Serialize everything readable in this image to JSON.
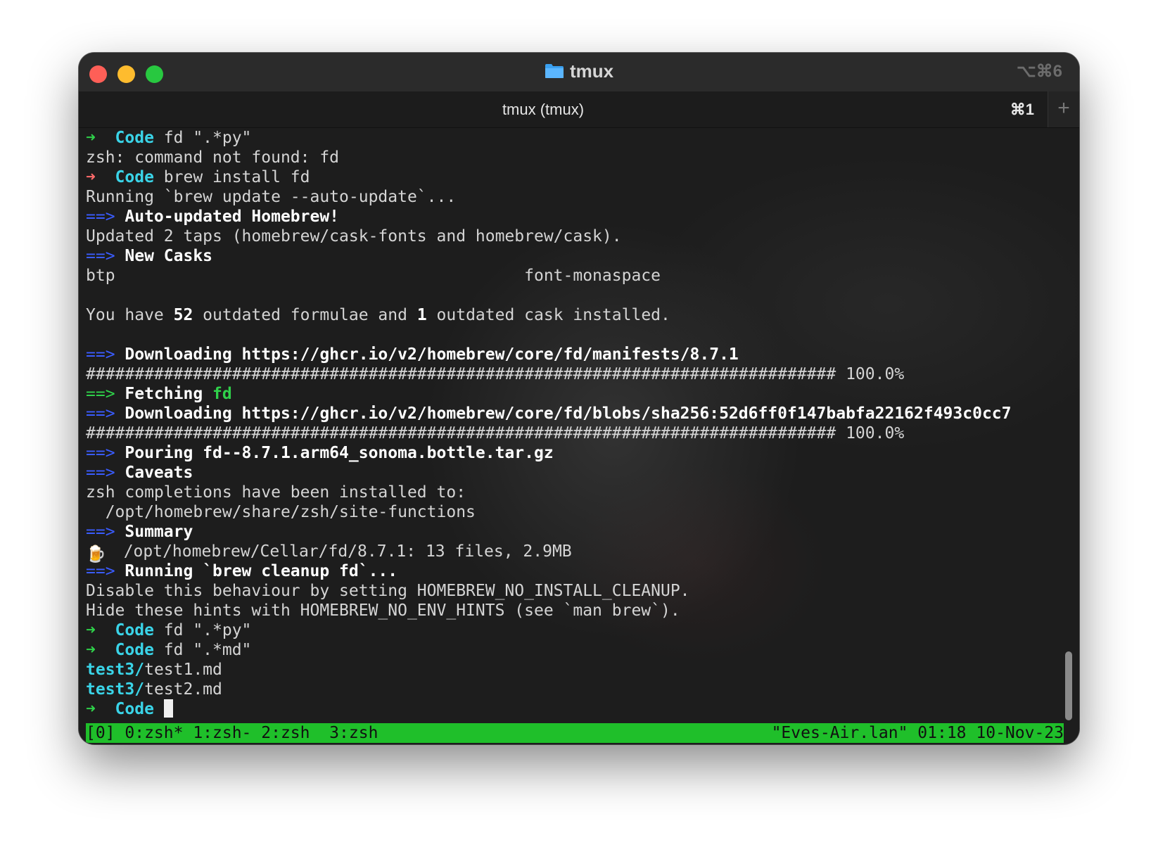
{
  "window": {
    "title": "tmux",
    "shortcut": "⌥⌘6",
    "tab_label": "tmux (tmux)",
    "tab_shortcut": "⌘1",
    "new_tab": "+"
  },
  "terminal": {
    "lines": [
      [
        {
          "t": "➜  ",
          "c": "g"
        },
        {
          "t": "Code",
          "c": "c"
        },
        {
          "t": " fd \".*py\"",
          "c": ""
        }
      ],
      [
        {
          "t": "zsh: command not found: fd",
          "c": ""
        }
      ],
      [
        {
          "t": "➜  ",
          "c": "r"
        },
        {
          "t": "Code",
          "c": "c"
        },
        {
          "t": " brew install fd",
          "c": ""
        }
      ],
      [
        {
          "t": "Running `brew update --auto-update`...",
          "c": ""
        }
      ],
      [
        {
          "t": "==> ",
          "c": "b"
        },
        {
          "t": "Auto-updated Homebrew!",
          "c": "w"
        }
      ],
      [
        {
          "t": "Updated 2 taps (homebrew/cask-fonts and homebrew/cask).",
          "c": ""
        }
      ],
      [
        {
          "t": "==> ",
          "c": "b"
        },
        {
          "t": "New Casks",
          "c": "w"
        }
      ],
      [
        {
          "t": "btp                                          font-monaspace",
          "c": ""
        }
      ],
      [
        {
          "t": "",
          "c": ""
        }
      ],
      [
        {
          "t": "You have ",
          "c": ""
        },
        {
          "t": "52",
          "c": "w"
        },
        {
          "t": " outdated formulae and ",
          "c": ""
        },
        {
          "t": "1",
          "c": "w"
        },
        {
          "t": " outdated cask installed.",
          "c": ""
        }
      ],
      [
        {
          "t": "",
          "c": ""
        }
      ],
      [
        {
          "t": "==> ",
          "c": "b"
        },
        {
          "t": "Downloading https://ghcr.io/v2/homebrew/core/fd/manifests/8.7.1",
          "c": "w"
        }
      ],
      [
        {
          "t": "############################################################################# 100.0%",
          "c": ""
        }
      ],
      [
        {
          "t": "==> ",
          "c": "g"
        },
        {
          "t": "Fetching ",
          "c": "w"
        },
        {
          "t": "fd",
          "c": "gr"
        }
      ],
      [
        {
          "t": "==> ",
          "c": "b"
        },
        {
          "t": "Downloading https://ghcr.io/v2/homebrew/core/fd/blobs/sha256:52d6ff0f147babfa22162f493c0cc7",
          "c": "w"
        }
      ],
      [
        {
          "t": "############################################################################# 100.0%",
          "c": ""
        }
      ],
      [
        {
          "t": "==> ",
          "c": "b"
        },
        {
          "t": "Pouring fd--8.7.1.arm64_sonoma.bottle.tar.gz",
          "c": "w"
        }
      ],
      [
        {
          "t": "==> ",
          "c": "b"
        },
        {
          "t": "Caveats",
          "c": "w"
        }
      ],
      [
        {
          "t": "zsh completions have been installed to:",
          "c": ""
        }
      ],
      [
        {
          "t": "  /opt/homebrew/share/zsh/site-functions",
          "c": ""
        }
      ],
      [
        {
          "t": "==> ",
          "c": "b"
        },
        {
          "t": "Summary",
          "c": "w"
        }
      ],
      [
        {
          "t": "🍺",
          "c": "icon"
        },
        {
          "t": "  /opt/homebrew/Cellar/fd/8.7.1: 13 files, 2.9MB",
          "c": ""
        }
      ],
      [
        {
          "t": "==> ",
          "c": "b"
        },
        {
          "t": "Running `brew cleanup fd`...",
          "c": "w"
        }
      ],
      [
        {
          "t": "Disable this behaviour by setting HOMEBREW_NO_INSTALL_CLEANUP.",
          "c": ""
        }
      ],
      [
        {
          "t": "Hide these hints with HOMEBREW_NO_ENV_HINTS (see `man brew`).",
          "c": ""
        }
      ],
      [
        {
          "t": "➜  ",
          "c": "g"
        },
        {
          "t": "Code",
          "c": "c"
        },
        {
          "t": " fd \".*py\"",
          "c": ""
        }
      ],
      [
        {
          "t": "➜  ",
          "c": "g"
        },
        {
          "t": "Code",
          "c": "c"
        },
        {
          "t": " fd \".*md\"",
          "c": ""
        }
      ],
      [
        {
          "t": "test3/",
          "c": "c"
        },
        {
          "t": "test1.md",
          "c": ""
        }
      ],
      [
        {
          "t": "test3/",
          "c": "c"
        },
        {
          "t": "test2.md",
          "c": ""
        }
      ],
      [
        {
          "t": "➜  ",
          "c": "g"
        },
        {
          "t": "Code",
          "c": "c"
        },
        {
          "t": " ",
          "c": ""
        },
        {
          "t": "",
          "c": "cursor"
        }
      ]
    ]
  },
  "statusbar": {
    "left": "[0] 0:zsh* 1:zsh- 2:zsh  3:zsh",
    "right": "\"Eves-Air.lan\" 01:18 10-Nov-23",
    "color": "#1fbf2a"
  }
}
